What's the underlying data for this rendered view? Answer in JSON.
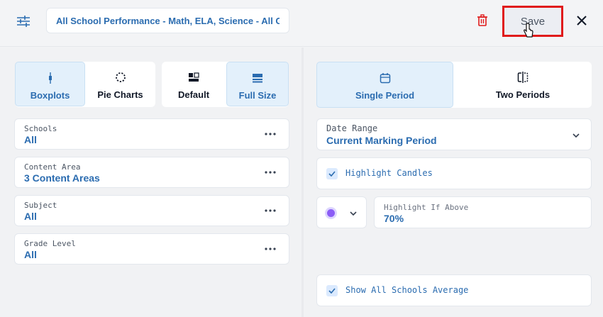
{
  "header": {
    "title": "All School Performance - Math, ELA, Science - All Grades",
    "save_label": "Save"
  },
  "view_toggles": {
    "chart_style": [
      {
        "label": "Boxplots",
        "active": true
      },
      {
        "label": "Pie Charts",
        "active": false
      }
    ],
    "size": [
      {
        "label": "Default",
        "active": false
      },
      {
        "label": "Full Size",
        "active": true
      }
    ]
  },
  "filters": [
    {
      "label": "Schools",
      "value": "All"
    },
    {
      "label": "Content Area",
      "value": "3 Content Areas"
    },
    {
      "label": "Subject",
      "value": "All"
    },
    {
      "label": "Grade Level",
      "value": "All"
    }
  ],
  "period_toggles": [
    {
      "label": "Single Period",
      "active": true
    },
    {
      "label": "Two Periods",
      "active": false
    }
  ],
  "date_range": {
    "label": "Date Range",
    "value": "Current Marking Period"
  },
  "highlight_candles": {
    "label": "Highlight Candles",
    "checked": true
  },
  "highlight_threshold": {
    "label": "Highlight If Above",
    "value": "70%",
    "color": "#8b5cf6"
  },
  "show_average": {
    "label": "Show All Schools Average",
    "checked": true
  },
  "colors": {
    "accent": "#2b6cb0",
    "active_bg": "#e3f0fb",
    "danger": "#e01b1b"
  }
}
